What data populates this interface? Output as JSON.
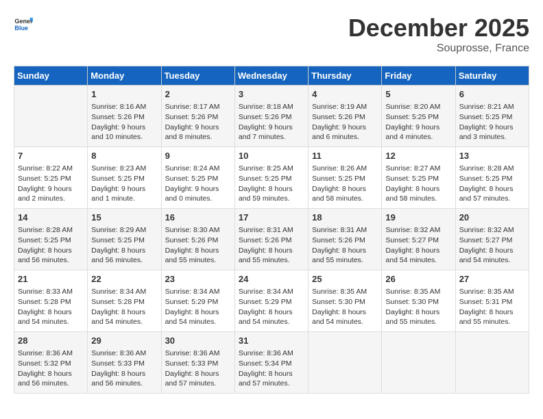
{
  "header": {
    "logo_general": "General",
    "logo_blue": "Blue",
    "month": "December 2025",
    "location": "Souprosse, France"
  },
  "days_of_week": [
    "Sunday",
    "Monday",
    "Tuesday",
    "Wednesday",
    "Thursday",
    "Friday",
    "Saturday"
  ],
  "weeks": [
    [
      {
        "day": "",
        "info": ""
      },
      {
        "day": "1",
        "info": "Sunrise: 8:16 AM\nSunset: 5:26 PM\nDaylight: 9 hours\nand 10 minutes."
      },
      {
        "day": "2",
        "info": "Sunrise: 8:17 AM\nSunset: 5:26 PM\nDaylight: 9 hours\nand 8 minutes."
      },
      {
        "day": "3",
        "info": "Sunrise: 8:18 AM\nSunset: 5:26 PM\nDaylight: 9 hours\nand 7 minutes."
      },
      {
        "day": "4",
        "info": "Sunrise: 8:19 AM\nSunset: 5:26 PM\nDaylight: 9 hours\nand 6 minutes."
      },
      {
        "day": "5",
        "info": "Sunrise: 8:20 AM\nSunset: 5:25 PM\nDaylight: 9 hours\nand 4 minutes."
      },
      {
        "day": "6",
        "info": "Sunrise: 8:21 AM\nSunset: 5:25 PM\nDaylight: 9 hours\nand 3 minutes."
      }
    ],
    [
      {
        "day": "7",
        "info": "Sunrise: 8:22 AM\nSunset: 5:25 PM\nDaylight: 9 hours\nand 2 minutes."
      },
      {
        "day": "8",
        "info": "Sunrise: 8:23 AM\nSunset: 5:25 PM\nDaylight: 9 hours\nand 1 minute."
      },
      {
        "day": "9",
        "info": "Sunrise: 8:24 AM\nSunset: 5:25 PM\nDaylight: 9 hours\nand 0 minutes."
      },
      {
        "day": "10",
        "info": "Sunrise: 8:25 AM\nSunset: 5:25 PM\nDaylight: 8 hours\nand 59 minutes."
      },
      {
        "day": "11",
        "info": "Sunrise: 8:26 AM\nSunset: 5:25 PM\nDaylight: 8 hours\nand 58 minutes."
      },
      {
        "day": "12",
        "info": "Sunrise: 8:27 AM\nSunset: 5:25 PM\nDaylight: 8 hours\nand 58 minutes."
      },
      {
        "day": "13",
        "info": "Sunrise: 8:28 AM\nSunset: 5:25 PM\nDaylight: 8 hours\nand 57 minutes."
      }
    ],
    [
      {
        "day": "14",
        "info": "Sunrise: 8:28 AM\nSunset: 5:25 PM\nDaylight: 8 hours\nand 56 minutes."
      },
      {
        "day": "15",
        "info": "Sunrise: 8:29 AM\nSunset: 5:25 PM\nDaylight: 8 hours\nand 56 minutes."
      },
      {
        "day": "16",
        "info": "Sunrise: 8:30 AM\nSunset: 5:26 PM\nDaylight: 8 hours\nand 55 minutes."
      },
      {
        "day": "17",
        "info": "Sunrise: 8:31 AM\nSunset: 5:26 PM\nDaylight: 8 hours\nand 55 minutes."
      },
      {
        "day": "18",
        "info": "Sunrise: 8:31 AM\nSunset: 5:26 PM\nDaylight: 8 hours\nand 55 minutes."
      },
      {
        "day": "19",
        "info": "Sunrise: 8:32 AM\nSunset: 5:27 PM\nDaylight: 8 hours\nand 54 minutes."
      },
      {
        "day": "20",
        "info": "Sunrise: 8:32 AM\nSunset: 5:27 PM\nDaylight: 8 hours\nand 54 minutes."
      }
    ],
    [
      {
        "day": "21",
        "info": "Sunrise: 8:33 AM\nSunset: 5:28 PM\nDaylight: 8 hours\nand 54 minutes."
      },
      {
        "day": "22",
        "info": "Sunrise: 8:34 AM\nSunset: 5:28 PM\nDaylight: 8 hours\nand 54 minutes."
      },
      {
        "day": "23",
        "info": "Sunrise: 8:34 AM\nSunset: 5:29 PM\nDaylight: 8 hours\nand 54 minutes."
      },
      {
        "day": "24",
        "info": "Sunrise: 8:34 AM\nSunset: 5:29 PM\nDaylight: 8 hours\nand 54 minutes."
      },
      {
        "day": "25",
        "info": "Sunrise: 8:35 AM\nSunset: 5:30 PM\nDaylight: 8 hours\nand 54 minutes."
      },
      {
        "day": "26",
        "info": "Sunrise: 8:35 AM\nSunset: 5:30 PM\nDaylight: 8 hours\nand 55 minutes."
      },
      {
        "day": "27",
        "info": "Sunrise: 8:35 AM\nSunset: 5:31 PM\nDaylight: 8 hours\nand 55 minutes."
      }
    ],
    [
      {
        "day": "28",
        "info": "Sunrise: 8:36 AM\nSunset: 5:32 PM\nDaylight: 8 hours\nand 56 minutes."
      },
      {
        "day": "29",
        "info": "Sunrise: 8:36 AM\nSunset: 5:33 PM\nDaylight: 8 hours\nand 56 minutes."
      },
      {
        "day": "30",
        "info": "Sunrise: 8:36 AM\nSunset: 5:33 PM\nDaylight: 8 hours\nand 57 minutes."
      },
      {
        "day": "31",
        "info": "Sunrise: 8:36 AM\nSunset: 5:34 PM\nDaylight: 8 hours\nand 57 minutes."
      },
      {
        "day": "",
        "info": ""
      },
      {
        "day": "",
        "info": ""
      },
      {
        "day": "",
        "info": ""
      }
    ]
  ]
}
